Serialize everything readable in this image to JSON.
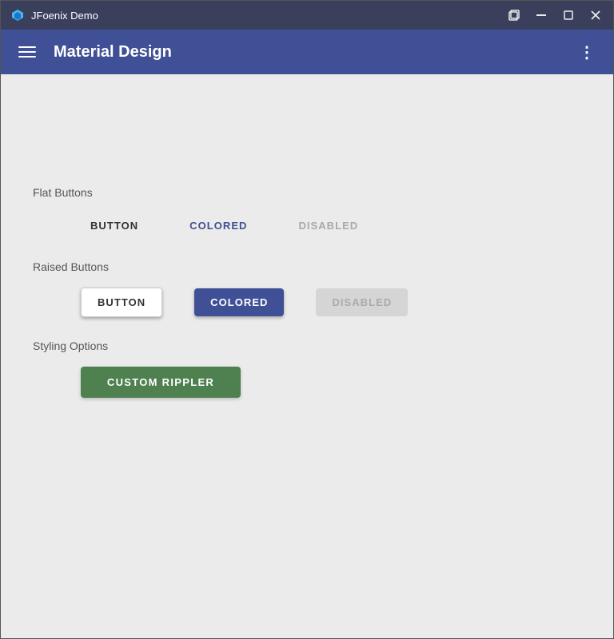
{
  "titleBar": {
    "appName": "JFoenix Demo",
    "controls": {
      "restore": "⛶",
      "minimize": "─",
      "maximize": "□",
      "close": "✕"
    }
  },
  "appBar": {
    "title": "Material Design",
    "moreIcon": "⋮"
  },
  "main": {
    "sections": [
      {
        "id": "flat-buttons",
        "label": "Flat Buttons",
        "buttons": [
          {
            "id": "flat-default",
            "label": "BUTTON",
            "style": "default"
          },
          {
            "id": "flat-colored",
            "label": "COLORED",
            "style": "colored"
          },
          {
            "id": "flat-disabled",
            "label": "DISABLED",
            "style": "disabled"
          }
        ]
      },
      {
        "id": "raised-buttons",
        "label": "Raised Buttons",
        "buttons": [
          {
            "id": "raised-default",
            "label": "BUTTON",
            "style": "default"
          },
          {
            "id": "raised-colored",
            "label": "COLORED",
            "style": "colored"
          },
          {
            "id": "raised-disabled",
            "label": "DISABLED",
            "style": "disabled"
          }
        ]
      },
      {
        "id": "styling-options",
        "label": "Styling Options",
        "buttons": [
          {
            "id": "custom-rippler",
            "label": "CUSTOM RIPPLER",
            "style": "custom"
          }
        ]
      }
    ]
  }
}
